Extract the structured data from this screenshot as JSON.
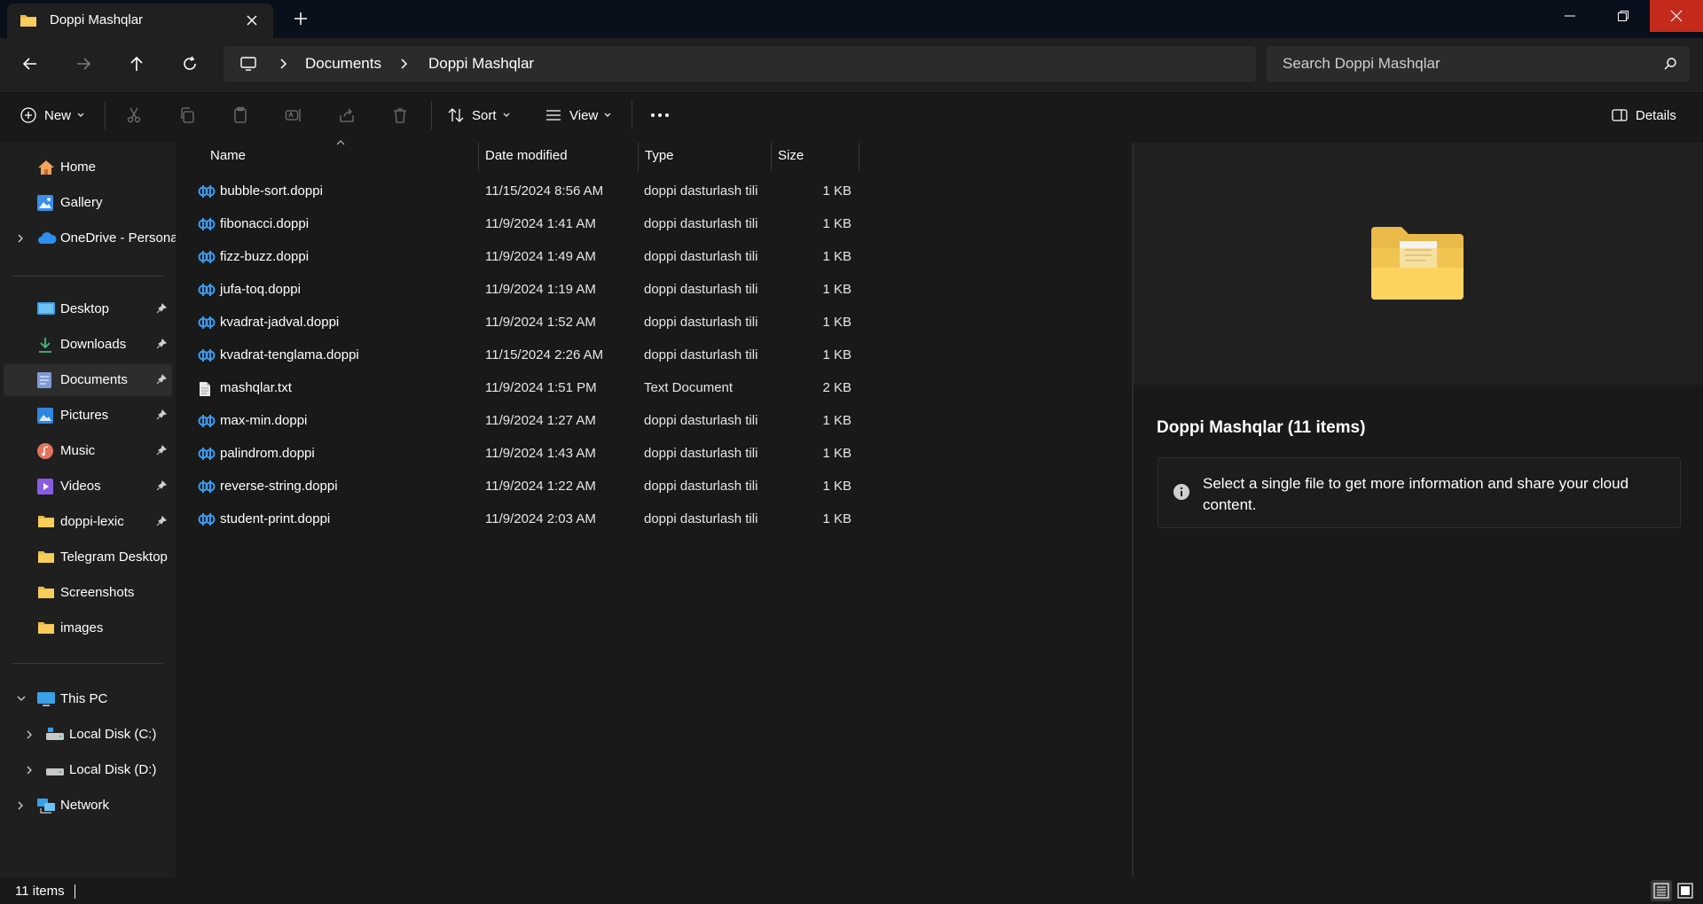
{
  "window": {
    "tab_title": "Doppi Mashqlar",
    "icons": {
      "tab": "folder-icon",
      "close": "close-icon",
      "new_tab": "plus-icon"
    }
  },
  "address_bar": {
    "crumbs": [
      "Documents",
      "Doppi Mashqlar"
    ],
    "search_placeholder": "Search Doppi Mashqlar"
  },
  "command_bar": {
    "new_label": "New",
    "sort_label": "Sort",
    "view_label": "View",
    "details_label": "Details"
  },
  "sidebar": {
    "items": [
      {
        "label": "Home",
        "icon": "home-icon"
      },
      {
        "label": "Gallery",
        "icon": "gallery-icon"
      },
      {
        "label": "OneDrive - Persona",
        "icon": "cloud-icon"
      },
      {
        "label": "Desktop",
        "icon": "desktop-icon"
      },
      {
        "label": "Downloads",
        "icon": "download-icon"
      },
      {
        "label": "Documents",
        "icon": "documents-icon"
      },
      {
        "label": "Pictures",
        "icon": "pictures-icon"
      },
      {
        "label": "Music",
        "icon": "music-icon"
      },
      {
        "label": "Videos",
        "icon": "videos-icon"
      },
      {
        "label": "doppi-lexic",
        "icon": "folder-icon"
      },
      {
        "label": "Telegram Desktop",
        "icon": "folder-icon"
      },
      {
        "label": "Screenshots",
        "icon": "folder-icon"
      },
      {
        "label": "images",
        "icon": "folder-icon"
      },
      {
        "label": "This PC",
        "icon": "pc-icon"
      },
      {
        "label": "Local Disk (C:)",
        "icon": "drive-icon"
      },
      {
        "label": "Local Disk (D:)",
        "icon": "drive-icon"
      },
      {
        "label": "Network",
        "icon": "network-icon"
      }
    ],
    "selected": "Documents"
  },
  "file_list": {
    "columns": [
      "Name",
      "Date modified",
      "Type",
      "Size"
    ],
    "rows": [
      {
        "name": "bubble-sort.doppi",
        "date": "11/15/2024 8:56 AM",
        "type": "doppi dasturlash tili",
        "size": "1 KB"
      },
      {
        "name": "fibonacci.doppi",
        "date": "11/9/2024 1:41 AM",
        "type": "doppi dasturlash tili",
        "size": "1 KB"
      },
      {
        "name": "fizz-buzz.doppi",
        "date": "11/9/2024 1:49 AM",
        "type": "doppi dasturlash tili",
        "size": "1 KB"
      },
      {
        "name": "jufa-toq.doppi",
        "date": "11/9/2024 1:19 AM",
        "type": "doppi dasturlash tili",
        "size": "1 KB"
      },
      {
        "name": "kvadrat-jadval.doppi",
        "date": "11/9/2024 1:52 AM",
        "type": "doppi dasturlash tili",
        "size": "1 KB"
      },
      {
        "name": "kvadrat-tenglama.doppi",
        "date": "11/15/2024 2:26 AM",
        "type": "doppi dasturlash tili",
        "size": "1 KB"
      },
      {
        "name": "mashqlar.txt",
        "date": "11/9/2024 1:51 PM",
        "type": "Text Document",
        "size": "2 KB"
      },
      {
        "name": "max-min.doppi",
        "date": "11/9/2024 1:27 AM",
        "type": "doppi dasturlash tili",
        "size": "1 KB"
      },
      {
        "name": "palindrom.doppi",
        "date": "11/9/2024 1:43 AM",
        "type": "doppi dasturlash tili",
        "size": "1 KB"
      },
      {
        "name": "reverse-string.doppi",
        "date": "11/9/2024 1:22 AM",
        "type": "doppi dasturlash tili",
        "size": "1 KB"
      },
      {
        "name": "student-print.doppi",
        "date": "11/9/2024 2:03 AM",
        "type": "doppi dasturlash tili",
        "size": "1 KB"
      }
    ]
  },
  "details_pane": {
    "title": "Doppi Mashqlar (11 items)",
    "info": "Select a single file to get more information and share your cloud content."
  },
  "status_bar": {
    "count": "11 items"
  },
  "colors": {
    "accent": "#4cc2ff",
    "close_red": "#c42b1c",
    "folder_yellow": "#f8c840",
    "doppi_blue": "#3b9bf0"
  }
}
